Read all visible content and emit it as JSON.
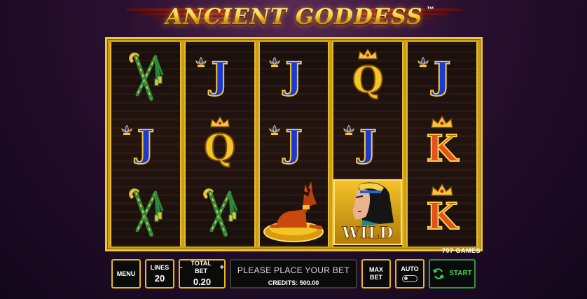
{
  "game": {
    "title": "ANCIENT GODDESS",
    "trademark": "™",
    "brand": "707 GAMES"
  },
  "reels": [
    [
      "pharaoh-staff",
      "J",
      "pharaoh-staff"
    ],
    [
      "J",
      "Q",
      "pharaoh-staff"
    ],
    [
      "J",
      "J",
      "anubis"
    ],
    [
      "Q",
      "J",
      "wild-goddess"
    ],
    [
      "J",
      "K",
      "K"
    ]
  ],
  "wild_label": "WILD",
  "controls": {
    "menu": "MENU",
    "lines_label": "LINES",
    "lines_value": "20",
    "bet_minus": "-",
    "bet_label": "TOTAL BET",
    "bet_plus": "+",
    "bet_value": "0.20",
    "message": "PLEASE PLACE YOUR BET",
    "credits": "CREDITS: 500.00",
    "max_bet_line1": "MAX",
    "max_bet_line2": "BET",
    "auto": "AUTO",
    "start": "START"
  },
  "colors": {
    "frame_gold": "#f0c63a",
    "j_blue": "#1a3bd0",
    "k_orange": "#e2521a",
    "start_green": "#3fd05a"
  }
}
